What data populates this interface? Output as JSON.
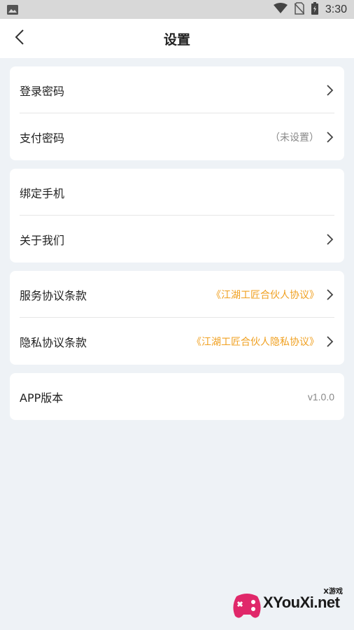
{
  "status": {
    "time": "3:30"
  },
  "header": {
    "title": "设置"
  },
  "groups": [
    {
      "items": [
        {
          "label": "登录密码",
          "value": ""
        },
        {
          "label": "支付密码",
          "value": "（未设置）"
        }
      ]
    },
    {
      "items": [
        {
          "label": "绑定手机",
          "value": ""
        },
        {
          "label": "关于我们",
          "value": ""
        }
      ]
    },
    {
      "items": [
        {
          "label": "服务协议条款",
          "value": "《江湖工匠合伙人协议》"
        },
        {
          "label": "隐私协议条款",
          "value": "《江湖工匠合伙人隐私协议》"
        }
      ]
    },
    {
      "items": [
        {
          "label": "APP版本",
          "value": "v1.0.0"
        }
      ]
    }
  ],
  "watermark": {
    "text": "XYouXi.net",
    "small": "X游戏"
  },
  "colors": {
    "accent": "#f0a020",
    "background": "#eef2f6"
  },
  "icons": [
    "image-icon",
    "wifi-icon",
    "no-sim-icon",
    "battery-icon",
    "back-arrow-icon",
    "chevron-right-icon"
  ]
}
